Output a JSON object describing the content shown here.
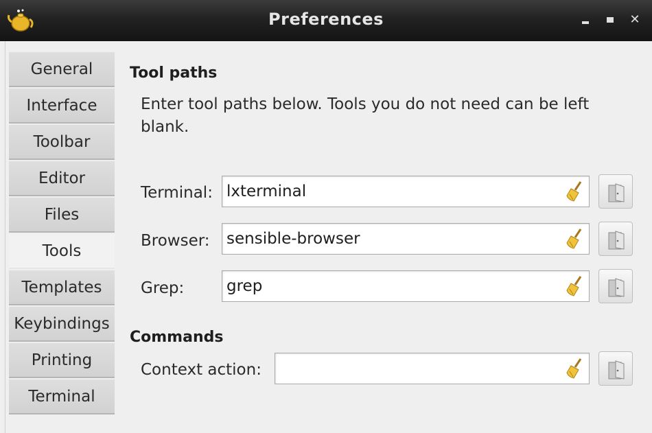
{
  "window": {
    "title": "Preferences"
  },
  "sidebar": {
    "tabs": [
      {
        "label": "General",
        "active": false
      },
      {
        "label": "Interface",
        "active": false
      },
      {
        "label": "Toolbar",
        "active": false
      },
      {
        "label": "Editor",
        "active": false
      },
      {
        "label": "Files",
        "active": false
      },
      {
        "label": "Tools",
        "active": true
      },
      {
        "label": "Templates",
        "active": false
      },
      {
        "label": "Keybindings",
        "active": false
      },
      {
        "label": "Printing",
        "active": false
      },
      {
        "label": "Terminal",
        "active": false
      }
    ]
  },
  "tool_paths": {
    "heading": "Tool paths",
    "description": "Enter tool paths below. Tools you do not need can be left blank.",
    "terminal": {
      "label": "Terminal:",
      "value": "lxterminal"
    },
    "browser": {
      "label": "Browser:",
      "value": "sensible-browser"
    },
    "grep": {
      "label": "Grep:",
      "value": "grep"
    }
  },
  "commands": {
    "heading": "Commands",
    "context_action": {
      "label": "Context action:",
      "value": ""
    }
  },
  "icons": {
    "app": "teapot-icon",
    "clear": "broom-icon",
    "browse": "folder-open-icon"
  }
}
